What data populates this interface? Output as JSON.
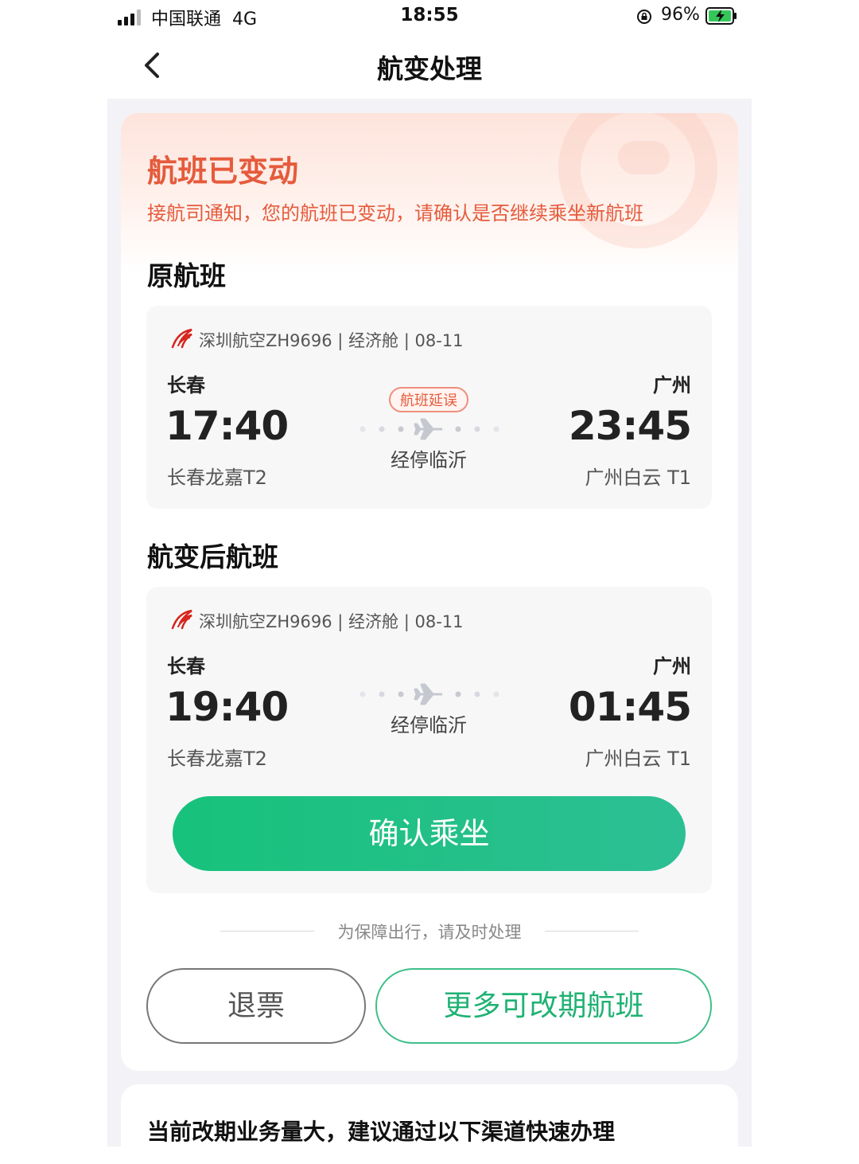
{
  "status_bar": {
    "carrier": "中国联通",
    "network": "4G",
    "time": "18:55",
    "battery": "96%"
  },
  "nav": {
    "title": "航变处理",
    "back_icon": "chevron-left-icon"
  },
  "alert": {
    "title": "航班已变动",
    "subtitle": "接航司通知，您的航班已变动，请确认是否继续乘坐新航班"
  },
  "original": {
    "section_title": "原航班",
    "flight_info": "深圳航空ZH9696 | 经济舱 | 08-11",
    "badge": "航班延误",
    "from_city": "长春",
    "from_time": "17:40",
    "from_terminal": "长春龙嘉T2",
    "stopover": "经停临沂",
    "to_city": "广州",
    "to_time": "23:45",
    "to_terminal": "广州白云 T1"
  },
  "changed": {
    "section_title": "航变后航班",
    "flight_info": "深圳航空ZH9696 | 经济舱 | 08-11",
    "from_city": "长春",
    "from_time": "19:40",
    "from_terminal": "长春龙嘉T2",
    "stopover": "经停临沂",
    "to_city": "广州",
    "to_time": "01:45",
    "to_terminal": "广州白云 T1",
    "confirm_label": "确认乘坐"
  },
  "hint": "为保障出行，请及时处理",
  "actions": {
    "refund_label": "退票",
    "more_label": "更多可改期航班"
  },
  "notice": {
    "title": "当前改期业务量大，建议通过以下渠道快速办理"
  },
  "colors": {
    "accent_green": "#1fb273",
    "alert_red": "#e55b3c",
    "page_bg": "#f3f2f6"
  }
}
